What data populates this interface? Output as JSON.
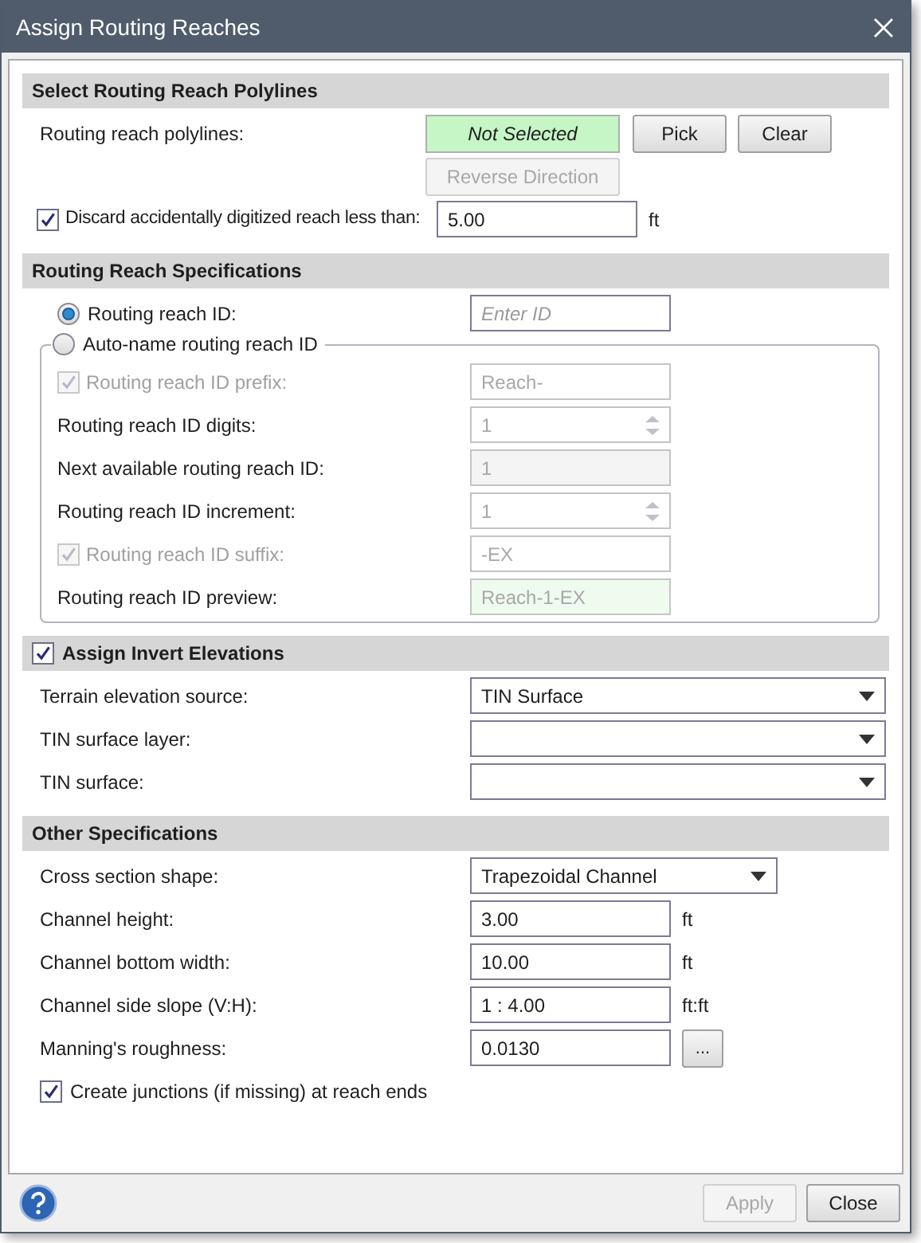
{
  "window": {
    "title": "Assign Routing Reaches"
  },
  "sections": [
    {
      "title": "Select Routing Reach Polylines",
      "rows": [
        {
          "kind": "selection",
          "label": "Routing reach polylines:",
          "status": "Not Selected",
          "buttons": [
            {
              "label": "Pick",
              "disabled": false
            },
            {
              "label": "Clear",
              "disabled": false
            }
          ]
        },
        {
          "kind": "button",
          "label": "Reverse Direction",
          "disabled": true
        },
        {
          "kind": "field",
          "label": "Discard accidentally digitized reach less than:",
          "checked": true,
          "value": "5.00",
          "unit": "ft"
        }
      ]
    },
    {
      "title": "Routing Reach Specifications",
      "rows": [
        {
          "kind": "radio_field",
          "label": "Routing reach ID:",
          "selected": true,
          "placeholder": "Enter ID"
        },
        {
          "kind": "radio_group",
          "label": "Auto-name routing reach ID",
          "selected": false,
          "rows": [
            {
              "kind": "field",
              "label": "Routing reach ID prefix:",
              "checked": true,
              "disabled": true,
              "value": "Reach-"
            },
            {
              "kind": "spin",
              "label": "Routing reach ID digits:",
              "disabled": true,
              "value": "1"
            },
            {
              "kind": "readonly",
              "label": "Next available routing reach ID:",
              "disabled": true,
              "value": "1"
            },
            {
              "kind": "spin",
              "label": "Routing reach ID increment:",
              "disabled": true,
              "value": "1"
            },
            {
              "kind": "field",
              "label": "Routing reach ID suffix:",
              "checked": true,
              "disabled": true,
              "value": "-EX"
            },
            {
              "kind": "preview",
              "label": "Routing reach ID preview:",
              "disabled": true,
              "value": "Reach-1-EX"
            }
          ]
        }
      ]
    },
    {
      "title": "Assign Invert Elevations",
      "checked": true,
      "rows": [
        {
          "kind": "dropdown",
          "label": "Terrain elevation source:",
          "value": "TIN Surface"
        },
        {
          "kind": "dropdown",
          "label": "TIN surface layer:"
        },
        {
          "kind": "dropdown",
          "label": "TIN surface:"
        }
      ]
    },
    {
      "title": "Other Specifications",
      "rows": [
        {
          "kind": "dropdown",
          "label": "Cross section shape:",
          "value": "Trapezoidal Channel"
        },
        {
          "kind": "field",
          "label": "Channel height:",
          "value": "3.00",
          "unit": "ft"
        },
        {
          "kind": "field",
          "label": "Channel bottom width:",
          "value": "10.00",
          "unit": "ft"
        },
        {
          "kind": "field",
          "label": "Channel side slope (V:H):",
          "value": "1 : 4.00",
          "unit": "ft:ft"
        },
        {
          "kind": "field",
          "label": "Manning's roughness:",
          "value": "0.0130",
          "button": "..."
        },
        {
          "kind": "checkbox",
          "label": "Create junctions (if missing) at reach ends",
          "checked": true
        }
      ]
    }
  ],
  "footer": {
    "buttons": [
      {
        "label": "Apply",
        "disabled": true
      },
      {
        "label": "Close",
        "disabled": false
      }
    ]
  }
}
